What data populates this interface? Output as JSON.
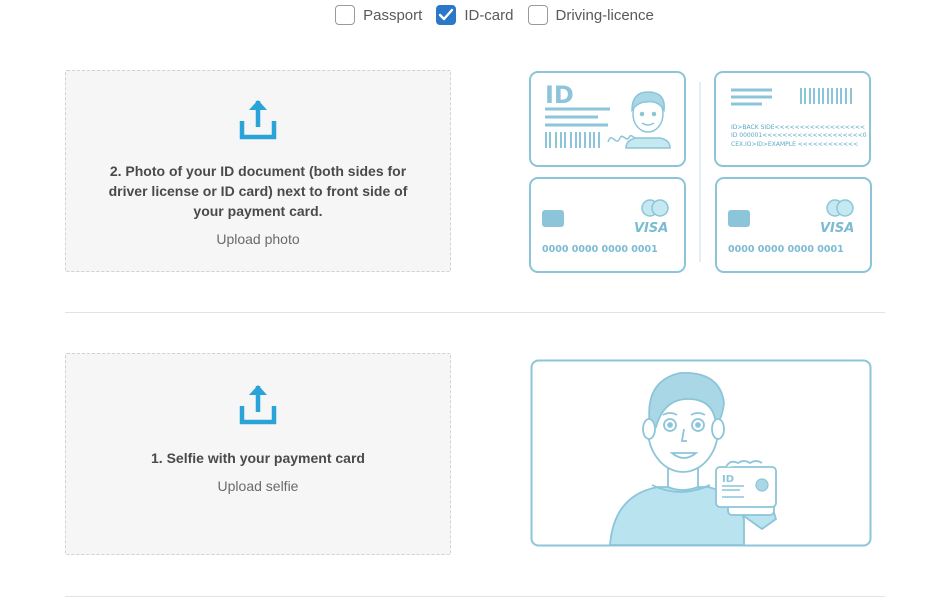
{
  "doc_types": {
    "options": [
      {
        "label": "Passport",
        "checked": false
      },
      {
        "label": "ID-card",
        "checked": true
      },
      {
        "label": "Driving-licence",
        "checked": false
      }
    ]
  },
  "upload_document": {
    "title": "2. Photo of your ID document (both sides for driver license or ID card) next to front side of your payment card.",
    "action": "Upload photo",
    "icon": "upload-icon"
  },
  "upload_selfie": {
    "title": "1. Selfie with your payment card",
    "action": "Upload selfie",
    "icon": "upload-icon"
  },
  "illustration_docs": {
    "id_front_text": "ID",
    "id_back_lines": [
      "ID>BACK SIDE<<<<<<<<<<<<<<<<<<",
      "ID 000001<<<<<<<<<<<<<<<<<<<<0",
      "CEX.IO>ID>EXAMPLE <<<<<<<<<<<<"
    ],
    "card_number": "0000 0000 0000 0001",
    "card_brand": "VISA"
  },
  "illustration_selfie": {
    "id_text": "ID"
  },
  "colors": {
    "accent": "#2b78c9",
    "upload_icon": "#2aa3d8",
    "illustration_stroke": "#8cc5d9",
    "illustration_fill": "#b9e3ee"
  }
}
